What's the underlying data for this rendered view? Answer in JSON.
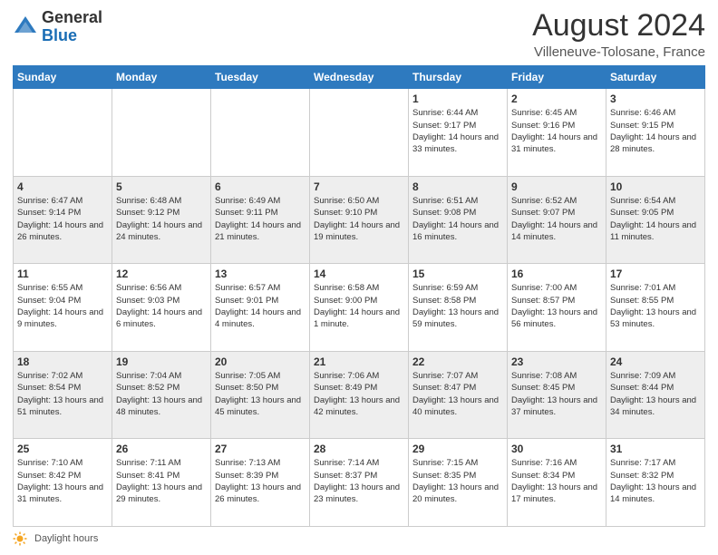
{
  "header": {
    "logo_general": "General",
    "logo_blue": "Blue",
    "month_title": "August 2024",
    "location": "Villeneuve-Tolosane, France"
  },
  "days_of_week": [
    "Sunday",
    "Monday",
    "Tuesday",
    "Wednesday",
    "Thursday",
    "Friday",
    "Saturday"
  ],
  "weeks": [
    [
      {
        "day": "",
        "sunrise": "",
        "sunset": "",
        "daylight": ""
      },
      {
        "day": "",
        "sunrise": "",
        "sunset": "",
        "daylight": ""
      },
      {
        "day": "",
        "sunrise": "",
        "sunset": "",
        "daylight": ""
      },
      {
        "day": "",
        "sunrise": "",
        "sunset": "",
        "daylight": ""
      },
      {
        "day": "1",
        "sunrise": "Sunrise: 6:44 AM",
        "sunset": "Sunset: 9:17 PM",
        "daylight": "Daylight: 14 hours and 33 minutes."
      },
      {
        "day": "2",
        "sunrise": "Sunrise: 6:45 AM",
        "sunset": "Sunset: 9:16 PM",
        "daylight": "Daylight: 14 hours and 31 minutes."
      },
      {
        "day": "3",
        "sunrise": "Sunrise: 6:46 AM",
        "sunset": "Sunset: 9:15 PM",
        "daylight": "Daylight: 14 hours and 28 minutes."
      }
    ],
    [
      {
        "day": "4",
        "sunrise": "Sunrise: 6:47 AM",
        "sunset": "Sunset: 9:14 PM",
        "daylight": "Daylight: 14 hours and 26 minutes."
      },
      {
        "day": "5",
        "sunrise": "Sunrise: 6:48 AM",
        "sunset": "Sunset: 9:12 PM",
        "daylight": "Daylight: 14 hours and 24 minutes."
      },
      {
        "day": "6",
        "sunrise": "Sunrise: 6:49 AM",
        "sunset": "Sunset: 9:11 PM",
        "daylight": "Daylight: 14 hours and 21 minutes."
      },
      {
        "day": "7",
        "sunrise": "Sunrise: 6:50 AM",
        "sunset": "Sunset: 9:10 PM",
        "daylight": "Daylight: 14 hours and 19 minutes."
      },
      {
        "day": "8",
        "sunrise": "Sunrise: 6:51 AM",
        "sunset": "Sunset: 9:08 PM",
        "daylight": "Daylight: 14 hours and 16 minutes."
      },
      {
        "day": "9",
        "sunrise": "Sunrise: 6:52 AM",
        "sunset": "Sunset: 9:07 PM",
        "daylight": "Daylight: 14 hours and 14 minutes."
      },
      {
        "day": "10",
        "sunrise": "Sunrise: 6:54 AM",
        "sunset": "Sunset: 9:05 PM",
        "daylight": "Daylight: 14 hours and 11 minutes."
      }
    ],
    [
      {
        "day": "11",
        "sunrise": "Sunrise: 6:55 AM",
        "sunset": "Sunset: 9:04 PM",
        "daylight": "Daylight: 14 hours and 9 minutes."
      },
      {
        "day": "12",
        "sunrise": "Sunrise: 6:56 AM",
        "sunset": "Sunset: 9:03 PM",
        "daylight": "Daylight: 14 hours and 6 minutes."
      },
      {
        "day": "13",
        "sunrise": "Sunrise: 6:57 AM",
        "sunset": "Sunset: 9:01 PM",
        "daylight": "Daylight: 14 hours and 4 minutes."
      },
      {
        "day": "14",
        "sunrise": "Sunrise: 6:58 AM",
        "sunset": "Sunset: 9:00 PM",
        "daylight": "Daylight: 14 hours and 1 minute."
      },
      {
        "day": "15",
        "sunrise": "Sunrise: 6:59 AM",
        "sunset": "Sunset: 8:58 PM",
        "daylight": "Daylight: 13 hours and 59 minutes."
      },
      {
        "day": "16",
        "sunrise": "Sunrise: 7:00 AM",
        "sunset": "Sunset: 8:57 PM",
        "daylight": "Daylight: 13 hours and 56 minutes."
      },
      {
        "day": "17",
        "sunrise": "Sunrise: 7:01 AM",
        "sunset": "Sunset: 8:55 PM",
        "daylight": "Daylight: 13 hours and 53 minutes."
      }
    ],
    [
      {
        "day": "18",
        "sunrise": "Sunrise: 7:02 AM",
        "sunset": "Sunset: 8:54 PM",
        "daylight": "Daylight: 13 hours and 51 minutes."
      },
      {
        "day": "19",
        "sunrise": "Sunrise: 7:04 AM",
        "sunset": "Sunset: 8:52 PM",
        "daylight": "Daylight: 13 hours and 48 minutes."
      },
      {
        "day": "20",
        "sunrise": "Sunrise: 7:05 AM",
        "sunset": "Sunset: 8:50 PM",
        "daylight": "Daylight: 13 hours and 45 minutes."
      },
      {
        "day": "21",
        "sunrise": "Sunrise: 7:06 AM",
        "sunset": "Sunset: 8:49 PM",
        "daylight": "Daylight: 13 hours and 42 minutes."
      },
      {
        "day": "22",
        "sunrise": "Sunrise: 7:07 AM",
        "sunset": "Sunset: 8:47 PM",
        "daylight": "Daylight: 13 hours and 40 minutes."
      },
      {
        "day": "23",
        "sunrise": "Sunrise: 7:08 AM",
        "sunset": "Sunset: 8:45 PM",
        "daylight": "Daylight: 13 hours and 37 minutes."
      },
      {
        "day": "24",
        "sunrise": "Sunrise: 7:09 AM",
        "sunset": "Sunset: 8:44 PM",
        "daylight": "Daylight: 13 hours and 34 minutes."
      }
    ],
    [
      {
        "day": "25",
        "sunrise": "Sunrise: 7:10 AM",
        "sunset": "Sunset: 8:42 PM",
        "daylight": "Daylight: 13 hours and 31 minutes."
      },
      {
        "day": "26",
        "sunrise": "Sunrise: 7:11 AM",
        "sunset": "Sunset: 8:41 PM",
        "daylight": "Daylight: 13 hours and 29 minutes."
      },
      {
        "day": "27",
        "sunrise": "Sunrise: 7:13 AM",
        "sunset": "Sunset: 8:39 PM",
        "daylight": "Daylight: 13 hours and 26 minutes."
      },
      {
        "day": "28",
        "sunrise": "Sunrise: 7:14 AM",
        "sunset": "Sunset: 8:37 PM",
        "daylight": "Daylight: 13 hours and 23 minutes."
      },
      {
        "day": "29",
        "sunrise": "Sunrise: 7:15 AM",
        "sunset": "Sunset: 8:35 PM",
        "daylight": "Daylight: 13 hours and 20 minutes."
      },
      {
        "day": "30",
        "sunrise": "Sunrise: 7:16 AM",
        "sunset": "Sunset: 8:34 PM",
        "daylight": "Daylight: 13 hours and 17 minutes."
      },
      {
        "day": "31",
        "sunrise": "Sunrise: 7:17 AM",
        "sunset": "Sunset: 8:32 PM",
        "daylight": "Daylight: 13 hours and 14 minutes."
      }
    ]
  ],
  "footer": {
    "daylight_hours_label": "Daylight hours"
  }
}
